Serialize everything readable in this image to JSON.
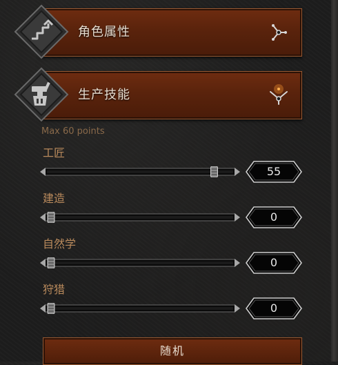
{
  "sections": [
    {
      "title": "角色属性",
      "icon": "attributes-icon",
      "state": "collapsed"
    },
    {
      "title": "生产技能",
      "icon": "crafting-icon",
      "state": "expanded"
    }
  ],
  "crafting": {
    "hint": "Max 60 points",
    "skills": [
      {
        "label": "工匠",
        "value": "55",
        "level": 55,
        "max": 60
      },
      {
        "label": "建造",
        "value": "0",
        "level": 0,
        "max": 60
      },
      {
        "label": "自然学",
        "value": "0",
        "level": 0,
        "max": 60
      },
      {
        "label": "狩猎",
        "value": "0",
        "level": 0,
        "max": 60
      }
    ]
  },
  "random_button": {
    "label": "随机"
  },
  "colors": {
    "accent": "#b98a5c",
    "panel": "#5a230c",
    "border": "#9a5a32",
    "hint": "#8a6a4a"
  }
}
